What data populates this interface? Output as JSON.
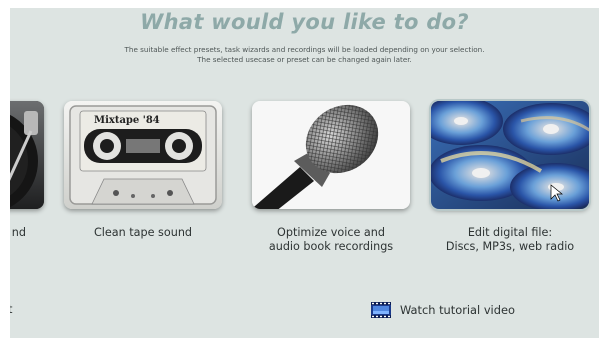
{
  "header": {
    "title": "What would you like to do?",
    "subtitle_line1": "The suitable effect presets, task wizards and recordings will be loaded depending on your selection.",
    "subtitle_line2": "The selected usecase or preset can be changed again later."
  },
  "options": [
    {
      "label_line1": "nd",
      "label_line2": "",
      "icon": "turntable-icon"
    },
    {
      "label_line1": "Clean tape sound",
      "label_line2": "",
      "icon": "cassette-icon",
      "tape_label": "Mixtape '84"
    },
    {
      "label_line1": "Optimize voice and",
      "label_line2": "audio book recordings",
      "icon": "microphone-icon"
    },
    {
      "label_line1": "Edit digital file:",
      "label_line2": "Discs, MP3s, web radio",
      "icon": "cd-icon"
    }
  ],
  "footer": {
    "left_link": "t",
    "tutorial_label": "Watch tutorial video",
    "tutorial_icon": "film-icon"
  },
  "colors": {
    "background": "#dde4e2",
    "title": "#8ea9a8",
    "text": "#2d3333"
  }
}
